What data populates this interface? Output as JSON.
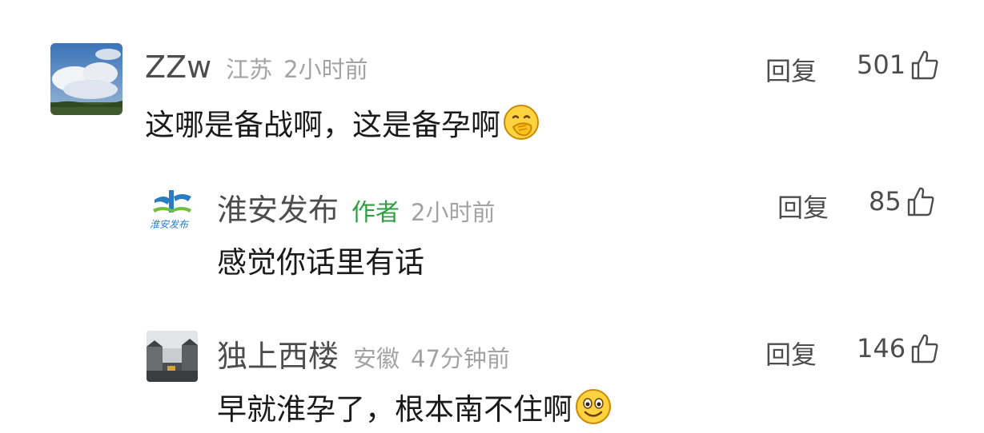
{
  "comments": [
    {
      "user": "ZZw",
      "region": "江苏",
      "time": "2小时前",
      "text": "这哪是备战啊，这是备孕啊",
      "emoji": "hand-over-mouth-emoji",
      "reply_label": "回复",
      "likes": "501"
    },
    {
      "user": "淮安发布",
      "author_tag": "作者",
      "time": "2小时前",
      "text": "感觉你话里有话",
      "reply_label": "回复",
      "likes": "85"
    },
    {
      "user": "独上西楼",
      "region": "安徽",
      "time": "47分钟前",
      "text": "早就淮孕了，根本南不住啊",
      "emoji": "smiling-emoji",
      "reply_label": "回复",
      "likes": "146"
    }
  ],
  "avatar_logo_text": "淮安发布",
  "colors": {
    "author_tag": "#2ea043",
    "meta": "#a3a3a3",
    "name": "#4d4d4d"
  }
}
